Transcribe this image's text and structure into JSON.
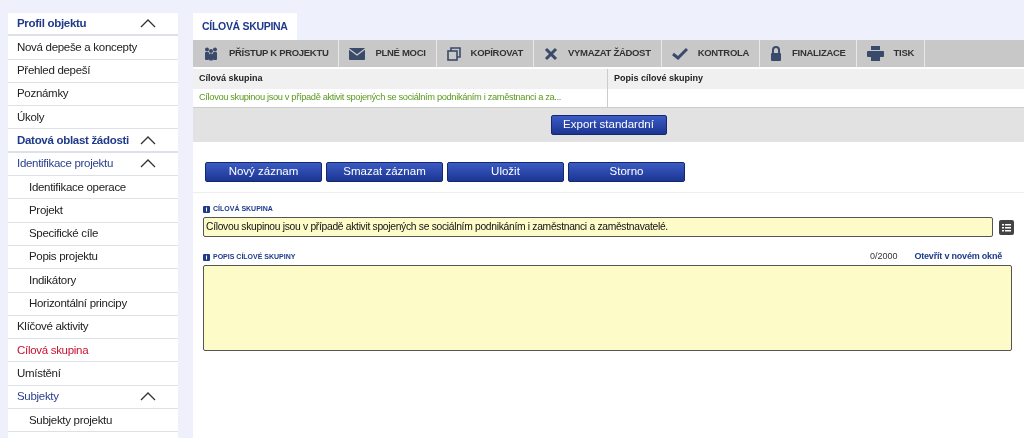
{
  "sidebar": {
    "items": [
      {
        "label": "Profil objektu",
        "kind": "section",
        "expanded": true,
        "selected": false
      },
      {
        "label": "Nová depeše a koncepty",
        "kind": "item",
        "selected": false
      },
      {
        "label": "Přehled depeší",
        "kind": "item",
        "selected": false
      },
      {
        "label": "Poznámky",
        "kind": "item",
        "selected": false
      },
      {
        "label": "Úkoly",
        "kind": "item",
        "selected": false
      },
      {
        "label": "Datová oblast žádosti",
        "kind": "section",
        "expanded": true,
        "selected": false
      },
      {
        "label": "Identifikace projektu",
        "kind": "group",
        "expanded": true,
        "selected": false
      },
      {
        "label": "Identifikace operace",
        "kind": "subitem",
        "selected": false
      },
      {
        "label": "Projekt",
        "kind": "subitem",
        "selected": false
      },
      {
        "label": "Specifické cíle",
        "kind": "subitem",
        "selected": false
      },
      {
        "label": "Popis projektu",
        "kind": "subitem",
        "selected": false
      },
      {
        "label": "Indikátory",
        "kind": "subitem",
        "selected": false
      },
      {
        "label": "Horizontální principy",
        "kind": "subitem",
        "selected": false
      },
      {
        "label": "Klíčové aktivity",
        "kind": "item",
        "selected": false
      },
      {
        "label": "Cílová skupina",
        "kind": "item",
        "selected": true
      },
      {
        "label": "Umístění",
        "kind": "item",
        "selected": false
      },
      {
        "label": "Subjekty",
        "kind": "group",
        "expanded": true,
        "selected": false
      },
      {
        "label": "Subjekty projektu",
        "kind": "subitem",
        "selected": false
      }
    ]
  },
  "tabs": [
    {
      "label": "CÍLOVÁ SKUPINA",
      "selected": true
    }
  ],
  "toolbar": [
    {
      "label": "PŘÍSTUP K PROJEKTU",
      "kind": "people"
    },
    {
      "label": "PLNÉ MOCI",
      "kind": "envelope"
    },
    {
      "label": "KOPÍROVAT",
      "kind": "copy"
    },
    {
      "label": "VYMAZAT ŽÁDOST",
      "kind": "cross"
    },
    {
      "label": "KONTROLA",
      "kind": "check"
    },
    {
      "label": "FINALIZACE",
      "kind": "lock"
    },
    {
      "label": "TISK",
      "kind": "printer"
    }
  ],
  "table": {
    "columns": [
      "Cílová skupina",
      "Popis cílové skupiny"
    ],
    "rows": [
      [
        "Cílovou skupinou jsou v případě aktivit spojených se sociálním podnikáním i zaměstnanci a za..."
      ]
    ]
  },
  "export_button": "Export standardní",
  "form_buttons": [
    "Nový záznam",
    "Smazat záznam",
    "Uložit",
    "Storno"
  ],
  "fields": [
    {
      "kind": "line",
      "label": "CÍLOVÁ SKUPINA",
      "value": "Cílovou skupinou jsou v případě aktivit spojených se sociálním podnikáním i zaměstnanci a zaměstnavatelé."
    },
    {
      "kind": "area",
      "label": "POPIS CÍLOVÉ SKUPINY",
      "counter": "0/2000",
      "link": "Otevřít v novém okně"
    }
  ]
}
